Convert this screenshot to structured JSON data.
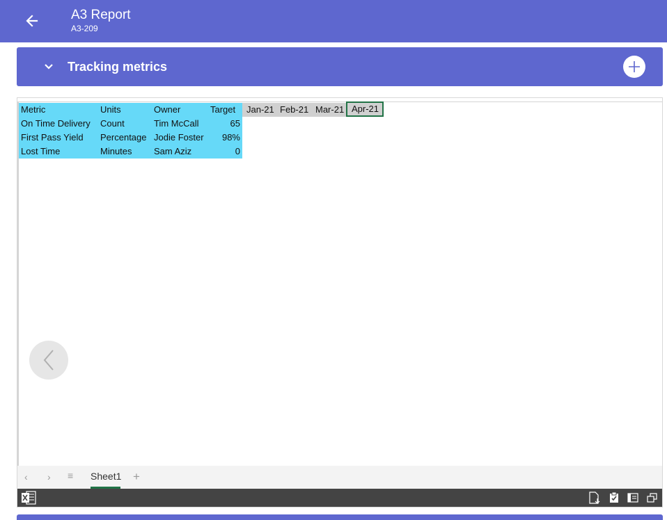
{
  "header": {
    "title": "A3 Report",
    "subtitle": "A3-209"
  },
  "section": {
    "title": "Tracking metrics"
  },
  "sheet": {
    "headers": {
      "metric": "Metric",
      "units": "Units",
      "owner": "Owner",
      "target": "Target"
    },
    "months": [
      "Jan-21",
      "Feb-21",
      "Mar-21",
      "Apr-21"
    ],
    "rows": [
      {
        "metric": "On Time Delivery",
        "units": "Count",
        "owner": "Tim McCall",
        "target": "65"
      },
      {
        "metric": "First Pass Yield",
        "units": "Percentage",
        "owner": "Jodie Foster",
        "target": "98%"
      },
      {
        "metric": "Lost Time",
        "units": "Minutes",
        "owner": "Sam Aziz",
        "target": "0"
      }
    ]
  },
  "tabs": {
    "active": "Sheet1"
  },
  "colors": {
    "header_bg": "#5e67cf",
    "cyan_fill": "#66d9f8",
    "month_fill": "#d0d0d0",
    "excel_green": "#217346",
    "status_bar": "#444444"
  },
  "icons": {
    "back": "arrow-left-icon",
    "expand": "chevron-down-icon",
    "add": "plus-icon",
    "prev": "chevron-left-icon",
    "excel": "excel-logo-icon"
  }
}
